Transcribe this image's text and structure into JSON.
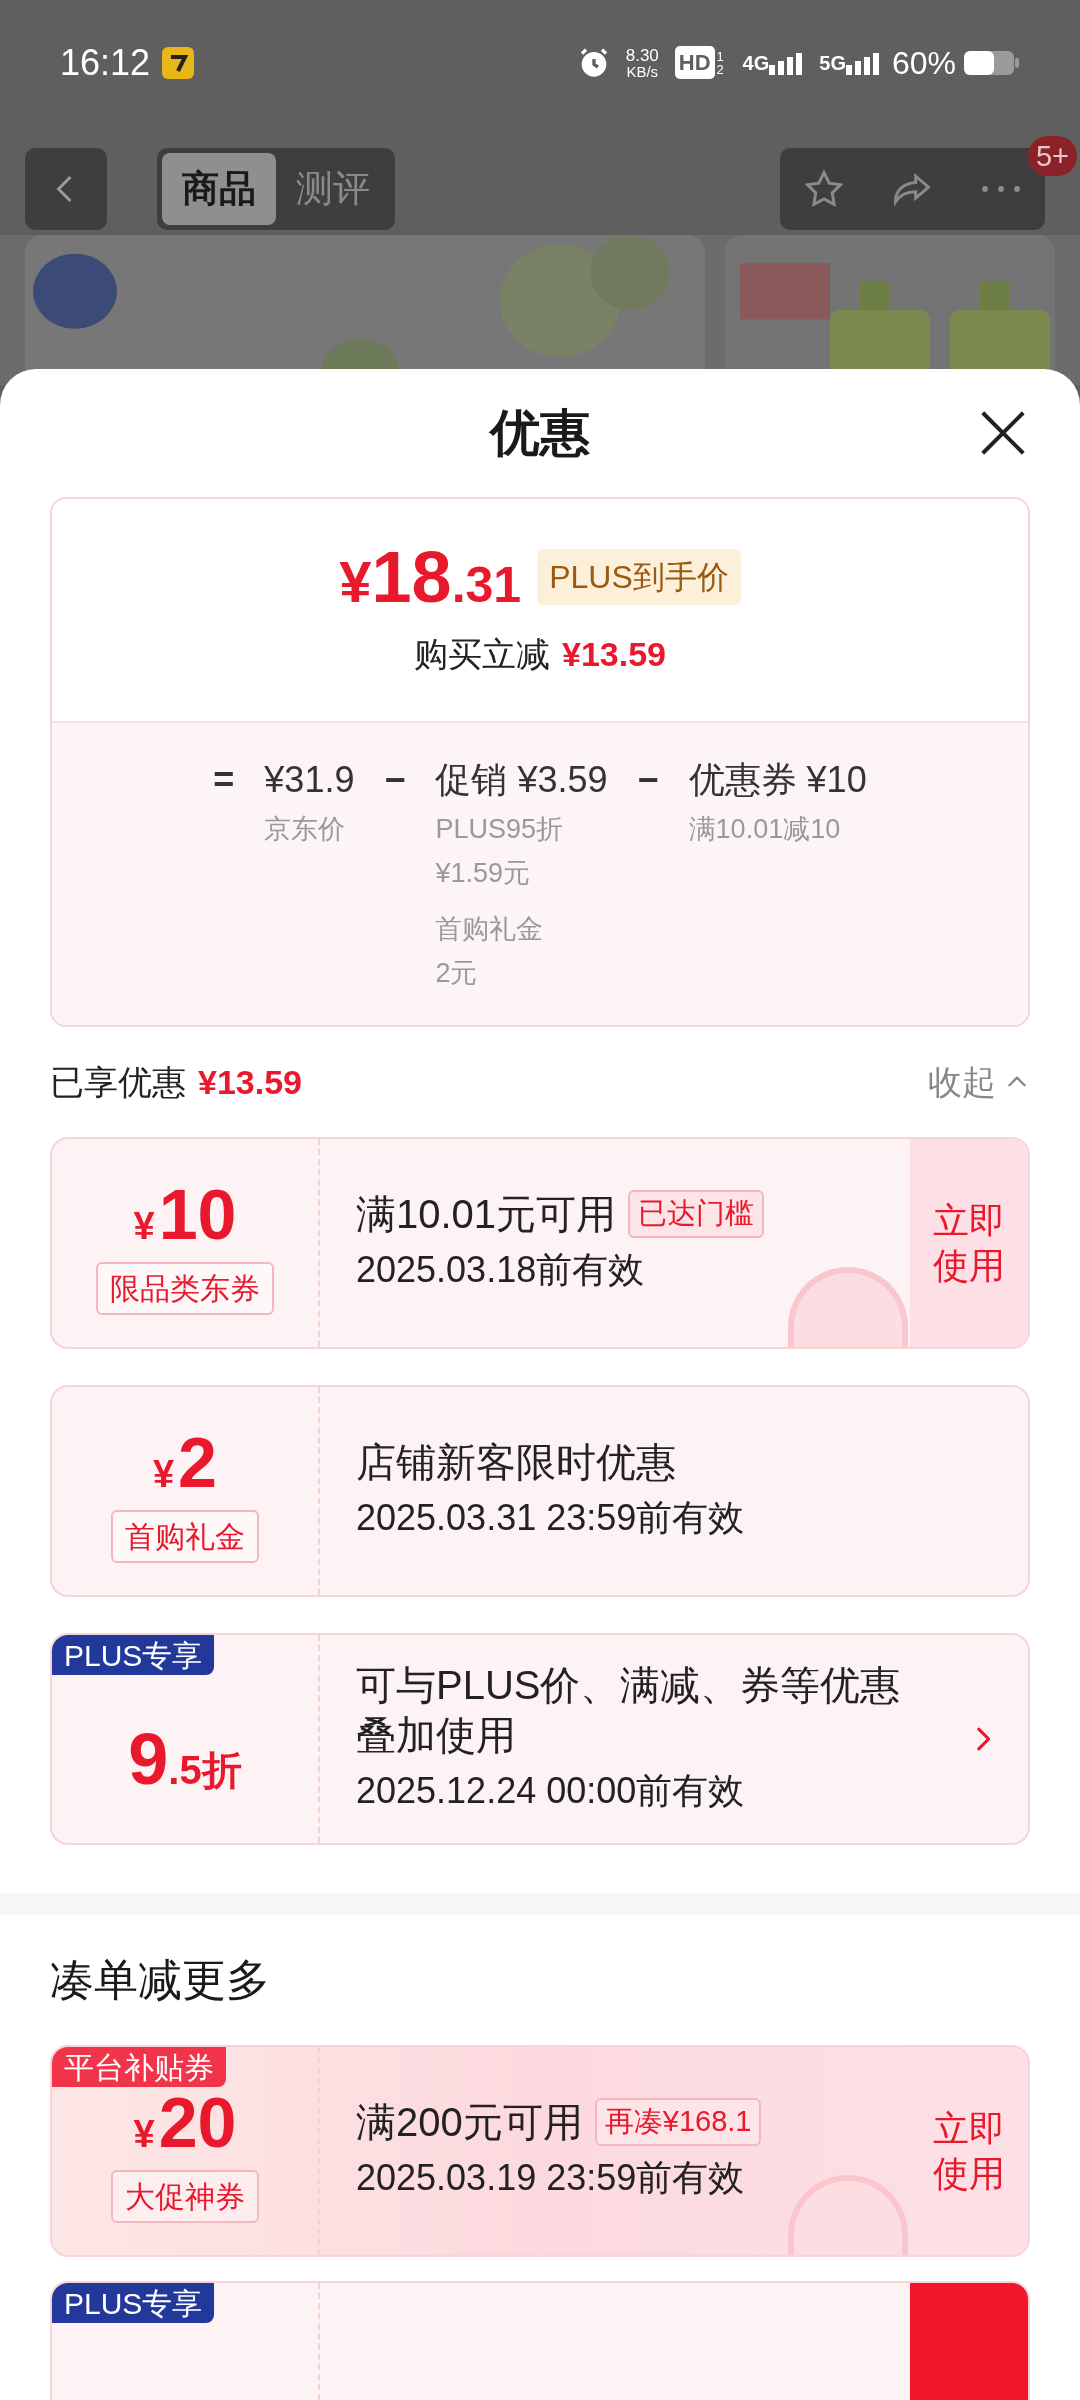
{
  "status_bar": {
    "time": "16:12",
    "speed": "8.30",
    "speed_unit": "KB/s",
    "hd_label": "HD",
    "hd_sub": "1 2",
    "net1": "4G",
    "net2": "5G",
    "battery": "60%"
  },
  "nav": {
    "tabs": [
      {
        "label": "商品",
        "selected": true
      },
      {
        "label": "测评",
        "selected": false
      }
    ],
    "badge": "5+"
  },
  "sheet": {
    "title": "优惠"
  },
  "summary": {
    "currency": "¥",
    "price_int": "18",
    "price_dec": ".31",
    "price_tag": "PLUS到手价",
    "cut_label": "购买立减",
    "cut_amount": "¥13.59",
    "breakdown": [
      {
        "op": "=",
        "amount": "¥31.9",
        "notes": [
          [
            "京东价"
          ]
        ]
      },
      {
        "op": "−",
        "amount": "促销 ¥3.59",
        "notes": [
          [
            "PLUS95折",
            "¥1.59元"
          ],
          [
            "首购礼金",
            "2元"
          ]
        ]
      },
      {
        "op": "−",
        "amount": "优惠券 ¥10",
        "notes": [
          [
            "满10.01减10"
          ]
        ]
      }
    ]
  },
  "enjoyed": {
    "label": "已享优惠",
    "amount": "¥13.59",
    "toggle": "收起",
    "expanded": true
  },
  "coupons": [
    {
      "kind": "coupon",
      "currency": "¥",
      "value": "10",
      "tag": "限品类东券",
      "title": "满10.01元可用",
      "badge": "已达门槛",
      "validity": "2025.03.18前有效",
      "action": "立即使用",
      "claimed": true
    },
    {
      "kind": "coupon",
      "currency": "¥",
      "value": "2",
      "tag": "首购礼金",
      "title": "店铺新客限时优惠",
      "validity": "2025.03.31 23:59前有效"
    },
    {
      "kind": "discount",
      "corner": "PLUS专享",
      "value": "9",
      "suffix": ".5折",
      "title": "可与PLUS价、满减、券等优惠叠加使用",
      "validity": "2025.12.24 00:00前有效"
    }
  ],
  "more": {
    "title": "凑单减更多",
    "coupons": [
      {
        "kind": "coupon",
        "corner": "平台补贴券",
        "fancy": true,
        "currency": "¥",
        "value": "20",
        "tag": "大促神券",
        "title": "满200元可用",
        "badge": "再凑¥168.1",
        "validity": "2025.03.19 23:59前有效",
        "action": "立即使用",
        "claimed": true
      },
      {
        "kind": "coupon",
        "corner": "PLUS专享",
        "action_solid": true
      }
    ]
  }
}
